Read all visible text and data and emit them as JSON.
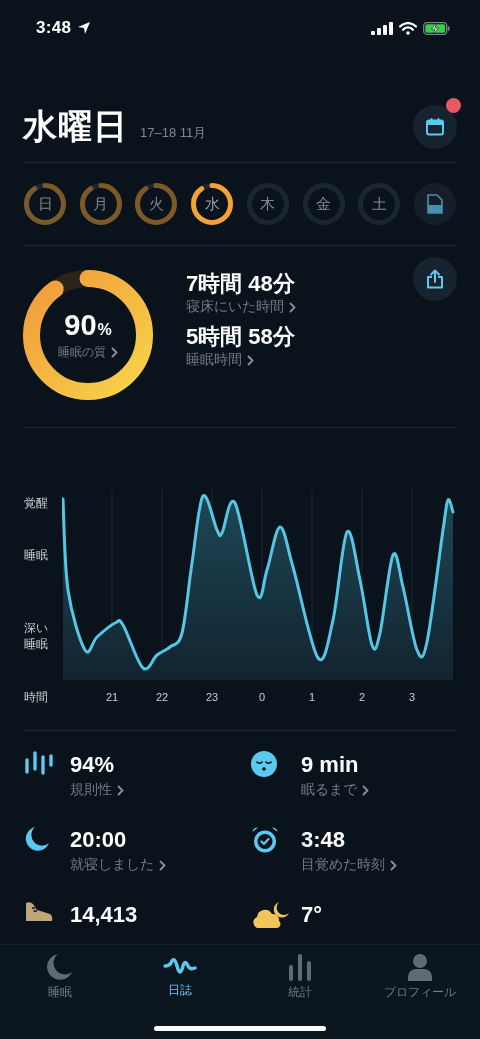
{
  "status_bar": {
    "time": "3:48"
  },
  "header": {
    "title": "水曜日",
    "date_range": "17–18 11月",
    "calendar_badge": true
  },
  "days": [
    {
      "label": "日",
      "recorded": true,
      "selected": false
    },
    {
      "label": "月",
      "recorded": true,
      "selected": false
    },
    {
      "label": "火",
      "recorded": true,
      "selected": false
    },
    {
      "label": "水",
      "recorded": true,
      "selected": true
    },
    {
      "label": "木",
      "recorded": false,
      "selected": false
    },
    {
      "label": "金",
      "recorded": false,
      "selected": false
    },
    {
      "label": "土",
      "recorded": false,
      "selected": false
    }
  ],
  "summary": {
    "quality": {
      "value": "90",
      "unit": "%",
      "label": "睡眠の質",
      "level": 0.9
    },
    "metrics": [
      {
        "value": "7時間 48分",
        "label": "寝床にいた時間"
      },
      {
        "value": "5時間 58分",
        "label": "睡眠時間"
      }
    ]
  },
  "sleep_graph": {
    "y_labels": [
      "覚醒",
      "睡眠",
      "深い睡眠"
    ],
    "x_label": "時間",
    "x_ticks": [
      "21",
      "22",
      "23",
      "0",
      "1",
      "2",
      "3"
    ]
  },
  "stats": [
    {
      "value": "94%",
      "label": "規則性"
    },
    {
      "value": "9 min",
      "label": "眠るまで"
    },
    {
      "value": "20:00",
      "label": "就寝しました"
    },
    {
      "value": "3:48",
      "label": "目覚めた時刻"
    },
    {
      "value": "14,413"
    },
    {
      "value": "7°"
    }
  ],
  "tabs": [
    {
      "label": "睡眠",
      "selected": false
    },
    {
      "label": "日誌",
      "selected": true
    },
    {
      "label": "統計",
      "selected": false
    },
    {
      "label": "プロフィール",
      "selected": false
    }
  ]
}
